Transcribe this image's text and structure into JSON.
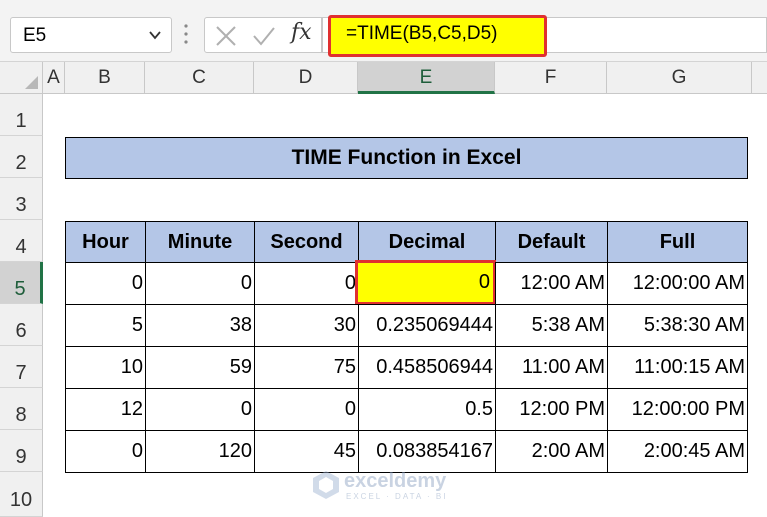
{
  "name_box": {
    "value": "E5"
  },
  "formula_bar": {
    "fx_label": "fx",
    "formula": "=TIME(B5,C5,D5)"
  },
  "columns": [
    "A",
    "B",
    "C",
    "D",
    "E",
    "F",
    "G"
  ],
  "selected_column": "E",
  "rows": [
    "1",
    "2",
    "3",
    "4",
    "5",
    "6",
    "7",
    "8",
    "9",
    "10"
  ],
  "selected_row": "5",
  "title": "TIME Function in Excel",
  "table": {
    "headers": [
      "Hour",
      "Minute",
      "Second",
      "Decimal",
      "Default",
      "Full"
    ],
    "rows": [
      [
        "0",
        "0",
        "0",
        "0",
        "12:00 AM",
        "12:00:00 AM"
      ],
      [
        "5",
        "38",
        "30",
        "0.235069444",
        "5:38 AM",
        "5:38:30 AM"
      ],
      [
        "10",
        "59",
        "75",
        "0.458506944",
        "11:00 AM",
        "11:00:15 AM"
      ],
      [
        "12",
        "0",
        "0",
        "0.5",
        "12:00 PM",
        "12:00:00 PM"
      ],
      [
        "0",
        "120",
        "45",
        "0.083854167",
        "2:00 AM",
        "2:00:45 AM"
      ]
    ]
  },
  "watermark": {
    "brand": "exceldemy",
    "tagline": "EXCEL · DATA · BI"
  },
  "colors": {
    "highlight": "#ffff00",
    "highlight_border": "#e03030",
    "header_fill": "#b4c6e7",
    "selected_header": "#217346"
  }
}
